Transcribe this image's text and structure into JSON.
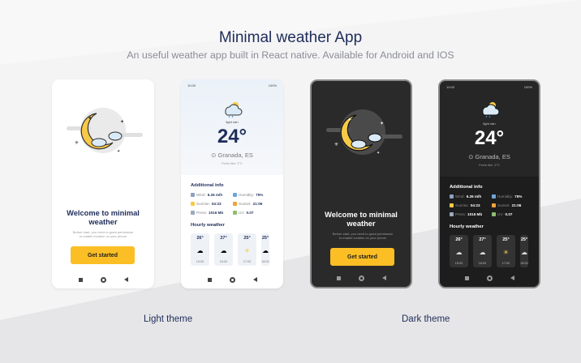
{
  "header": {
    "title": "Minimal weather App",
    "subtitle": "An useful weather app built in React native. Available for Android and IOS"
  },
  "labels": {
    "light_theme": "Light theme",
    "dark_theme": "Dark theme"
  },
  "welcome": {
    "title_line1": "Welcome to minimal",
    "title_line2": "weather",
    "permission_line1": "Before start, you need to grant permission",
    "permission_line2": "to enable location on your phone",
    "button": "Get started"
  },
  "status_bar": {
    "time": "10:00",
    "battery": "100%"
  },
  "weather": {
    "condition": "light rain",
    "temperature": "24°",
    "location": "Granada, ES",
    "feels_like": "Feels like: 2°C",
    "additional_title": "Additional info",
    "wind_label": "Wind:",
    "wind": "6.26 m/h",
    "humidity_label": "Humidity:",
    "humidity": "75%",
    "sunrise_label": "Sunrise:",
    "sunrise": "04:23",
    "sunset_label": "Sunset:",
    "sunset": "21:06",
    "press_label": "Press:",
    "press": "1016 Mb",
    "uv_label": "UV:",
    "uv": "0.07",
    "hourly_title": "Hourly weather",
    "hourly": [
      {
        "temp": "26°",
        "time": "15:00",
        "icon": "rain-cloud-icon"
      },
      {
        "temp": "27°",
        "time": "16:00",
        "icon": "rain-cloud-icon"
      },
      {
        "temp": "25°",
        "time": "17:00",
        "icon": "sun-icon"
      },
      {
        "temp": "25°",
        "time": "18:00",
        "icon": "cloud-icon"
      }
    ]
  },
  "colors": {
    "accent": "#fbbe24",
    "navy": "#1f2d5a",
    "dark_bg": "#262626"
  }
}
